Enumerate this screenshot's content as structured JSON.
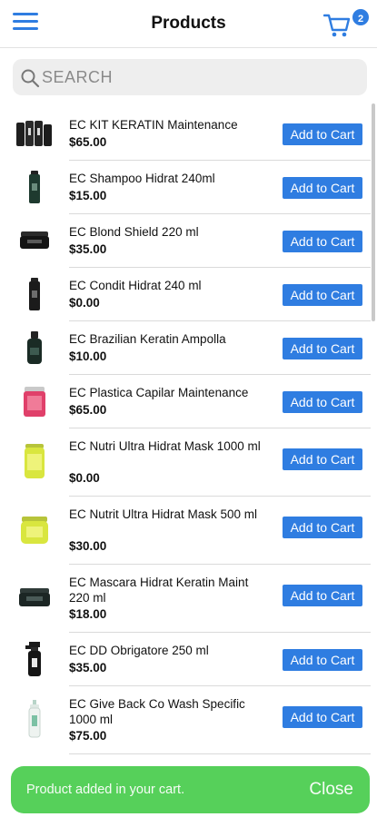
{
  "header": {
    "title": "Products",
    "cart_count": "2",
    "accent_color": "#2f7de1",
    "menu_icon": "hamburger-icon",
    "cart_icon": "cart-icon"
  },
  "search": {
    "placeholder": "SEARCH",
    "value": ""
  },
  "products": [
    {
      "name": "EC KIT KERATIN Maintenance",
      "price": "$65.00",
      "button": "Add to Cart"
    },
    {
      "name": "EC Shampoo Hidrat 240ml",
      "price": "$15.00",
      "button": "Add to Cart"
    },
    {
      "name": "EC Blond Shield 220 ml",
      "price": "$35.00",
      "button": "Add to Cart"
    },
    {
      "name": "EC Condit Hidrat 240 ml",
      "price": "$0.00",
      "button": "Add to Cart"
    },
    {
      "name": "EC Brazilian Keratin Ampolla",
      "price": "$10.00",
      "button": "Add to Cart"
    },
    {
      "name": "EC Plastica Capilar Maintenance",
      "price": "$65.00",
      "button": "Add to Cart"
    },
    {
      "name": "EC Nutri Ultra Hidrat Mask 1000 ml",
      "price": "$0.00",
      "button": "Add to Cart"
    },
    {
      "name": "EC Nutrit Ultra Hidrat Mask 500 ml",
      "price": "$30.00",
      "button": "Add to Cart"
    },
    {
      "name": "EC Mascara Hidrat Keratin Maint 220 ml",
      "price": "$18.00",
      "button": "Add to Cart"
    },
    {
      "name": "EC DD Obrigatore 250 ml",
      "price": "$35.00",
      "button": "Add to Cart"
    },
    {
      "name": "EC Give Back Co Wash Specific 1000 ml",
      "price": "$75.00",
      "button": "Add to Cart"
    }
  ],
  "toast": {
    "message": "Product added in your cart.",
    "close_label": "Close",
    "color": "#56d05a"
  }
}
